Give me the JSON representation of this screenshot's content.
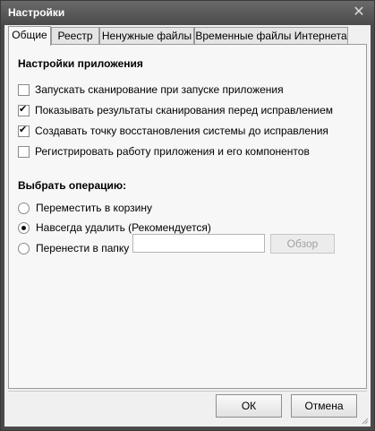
{
  "window": {
    "title": "Настройки"
  },
  "tabs": [
    {
      "label": "Общие"
    },
    {
      "label": "Реестр"
    },
    {
      "label": "Ненужные файлы"
    },
    {
      "label": "Временные файлы Интернета"
    }
  ],
  "app_settings": {
    "heading": "Настройки приложения",
    "options": [
      {
        "label": "Запускать сканирование при запуске приложения",
        "checked": false
      },
      {
        "label": "Показывать результаты сканирования перед исправлением",
        "checked": true
      },
      {
        "label": "Создавать точку восстановления системы до исправления",
        "checked": true
      },
      {
        "label": "Регистрировать работу приложения и его компонентов",
        "checked": false
      }
    ]
  },
  "operation": {
    "heading": "Выбрать операцию:",
    "options": [
      {
        "label": "Переместить в корзину",
        "selected": false
      },
      {
        "label": "Навсегда удалить (Рекомендуется)",
        "selected": true
      },
      {
        "label": "Перенести в папку",
        "selected": false
      }
    ],
    "folder_value": "",
    "browse_label": "Обзор"
  },
  "footer": {
    "ok_label": "ОК",
    "cancel_label": "Отмена"
  }
}
